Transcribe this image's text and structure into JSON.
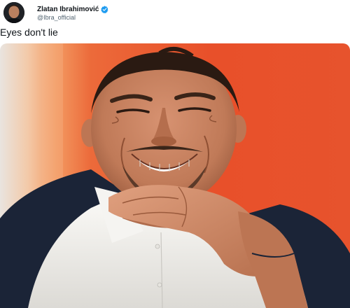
{
  "author": {
    "display_name": "Zlatan Ibrahimović",
    "handle": "@Ibra_official",
    "verified": true,
    "avatar_icon": "profile-photo"
  },
  "tweet": {
    "text": "Eyes don't lie"
  },
  "media": {
    "kind": "photo",
    "colors": {
      "background_orange": "#e8502a",
      "background_light": "#f4c6a2",
      "shirt_white": "#f2f1ee",
      "jacket_navy": "#1b2437",
      "skin": "#c8835f"
    }
  },
  "colors": {
    "verified_blue": "#1d9bf0",
    "handle_gray": "#536471",
    "text_black": "#0f1419"
  }
}
